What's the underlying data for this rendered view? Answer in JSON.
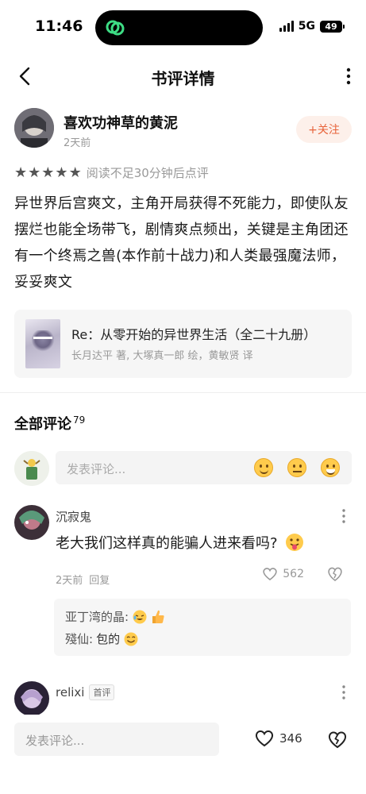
{
  "status_bar": {
    "time": "11:46",
    "network": "5G",
    "battery": "49"
  },
  "nav": {
    "title": "书评详情"
  },
  "review": {
    "author": "喜欢功神草的黄泥",
    "time": "2天前",
    "follow_label": "+关注",
    "stars": 5,
    "rating_note": "阅读不足30分钟后点评",
    "text": "异世界后宫爽文，主角开局获得不死能力，即使队友摆烂也能全场带飞，剧情爽点频出，关键是主角团还有一个终焉之兽(本作前十战力)和人类最强魔法师，妥妥爽文"
  },
  "book": {
    "title": "Re：从零开始的异世界生活（全二十九册）",
    "authors": "长月达平 著, 大塚真一郎 绘，黄敏贤 译"
  },
  "comments_section": {
    "heading": "全部评论",
    "count": "79",
    "input_placeholder": "发表评论..."
  },
  "comments": [
    {
      "user": "沉寂鬼",
      "text": "老大我们这样真的能骗人进来看吗?",
      "time": "2天前",
      "reply_label": "回复",
      "likes": "562",
      "replies": [
        {
          "user": "亚丁湾的晶:",
          "text": ""
        },
        {
          "user": "殘仙:",
          "text": "包的"
        }
      ]
    },
    {
      "user": "relixi",
      "tag": "首评"
    }
  ],
  "bottom_bar": {
    "placeholder": "发表评论...",
    "likes": "346"
  },
  "colors": {
    "accent": "#e8633a",
    "follow_bg": "#fdf0ea",
    "muted": "#999999"
  }
}
